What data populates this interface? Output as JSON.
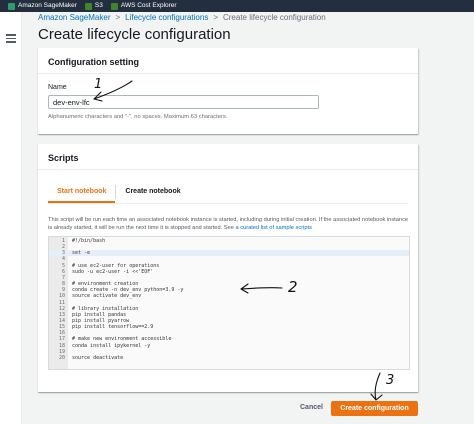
{
  "topbar": {
    "services": [
      {
        "label": "Amazon SageMaker",
        "icon": "sagemaker-icon",
        "color": "#2e9d6e"
      },
      {
        "label": "S3",
        "icon": "s3-icon",
        "color": "#3f8624"
      },
      {
        "label": "AWS Cost Explorer",
        "icon": "cost-explorer-icon",
        "color": "#3f8624"
      }
    ]
  },
  "breadcrumb": {
    "items": [
      "Amazon SageMaker",
      "Lifecycle configurations"
    ],
    "current": "Create lifecycle configuration",
    "separator": ">"
  },
  "page_title": "Create lifecycle configuration",
  "config_panel": {
    "title": "Configuration setting",
    "name_label": "Name",
    "name_value": "dev-env-lfc",
    "hint": "Alphanumeric characters and \"-\", no spaces. Maximum 63 characters."
  },
  "scripts_panel": {
    "title": "Scripts",
    "tabs": [
      "Start notebook",
      "Create notebook"
    ],
    "active_tab": "Start notebook",
    "description": "This script will be run each time an associated notebook instance is started, including during initial creation. If the associated notebook instance is already started, it will be run the next time it is stopped and started. See ",
    "description_link": "a curated list of sample scripts"
  },
  "editor": {
    "active_line": 3,
    "lines": [
      "#!/bin/bash",
      "",
      "set -e",
      "",
      "# use ec2-user for operations",
      "sudo -u ec2-user -i <<'EOF'",
      "",
      "# environment creation",
      "conda create -n dev_env python=3.9 -y",
      "source activate dev_env",
      "",
      "# library installation",
      "pip install pandas",
      "pip install pyarrow",
      "pip install tensorflow==2.9",
      "",
      "# make new environment accessible",
      "conda install ipykernel -y",
      "",
      "source deactivate"
    ]
  },
  "actions": {
    "cancel": "Cancel",
    "create": "Create configuration"
  },
  "annotations": [
    "1",
    "2",
    "3"
  ],
  "colors": {
    "accent": "#ec7211",
    "link": "#0073bb",
    "topbar": "#232f3e"
  }
}
